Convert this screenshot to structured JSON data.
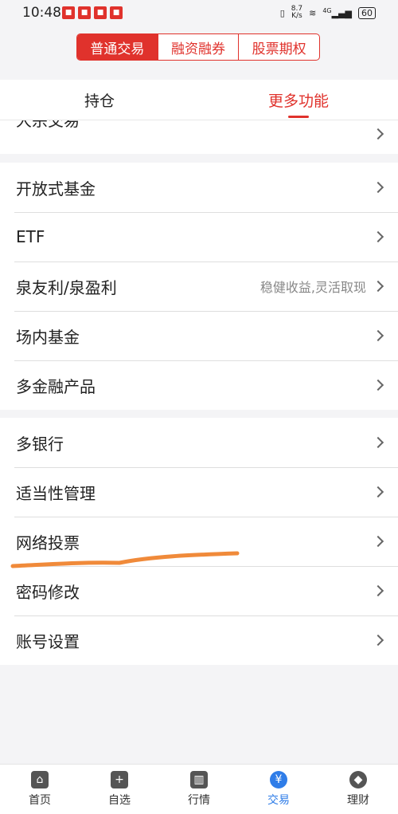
{
  "status": {
    "time": "10:48",
    "net_speed": "8.7\nK/s",
    "network": "4G",
    "battery": "60"
  },
  "segment": {
    "items": [
      "普通交易",
      "融资融券",
      "股票期权"
    ],
    "active_index": 0
  },
  "tabs": {
    "items": [
      "持仓",
      "更多功能"
    ],
    "active_index": 1
  },
  "menu": {
    "partial_label": "大宗交易",
    "group1": [
      {
        "label": "开放式基金",
        "sub": ""
      },
      {
        "label": "ETF",
        "sub": ""
      },
      {
        "label": "泉友利/泉盈利",
        "sub": "稳健收益,灵活取现"
      },
      {
        "label": "场内基金",
        "sub": ""
      },
      {
        "label": "多金融产品",
        "sub": ""
      }
    ],
    "group2": [
      {
        "label": "多银行",
        "sub": ""
      },
      {
        "label": "适当性管理",
        "sub": ""
      },
      {
        "label": "网络投票",
        "sub": ""
      },
      {
        "label": "密码修改",
        "sub": ""
      },
      {
        "label": "账号设置",
        "sub": ""
      }
    ]
  },
  "bottom_nav": {
    "items": [
      {
        "label": "首页",
        "icon": "home-icon",
        "glyph": "⌂"
      },
      {
        "label": "自选",
        "icon": "plus-icon",
        "glyph": "+"
      },
      {
        "label": "行情",
        "icon": "chart-icon",
        "glyph": "▥"
      },
      {
        "label": "交易",
        "icon": "yen-icon",
        "glyph": "¥"
      },
      {
        "label": "理财",
        "icon": "diamond-icon",
        "glyph": "◆"
      }
    ],
    "active_index": 3
  },
  "colors": {
    "accent": "#e0322c",
    "nav_active": "#2f7de8",
    "annotation": "#f08a3a"
  }
}
